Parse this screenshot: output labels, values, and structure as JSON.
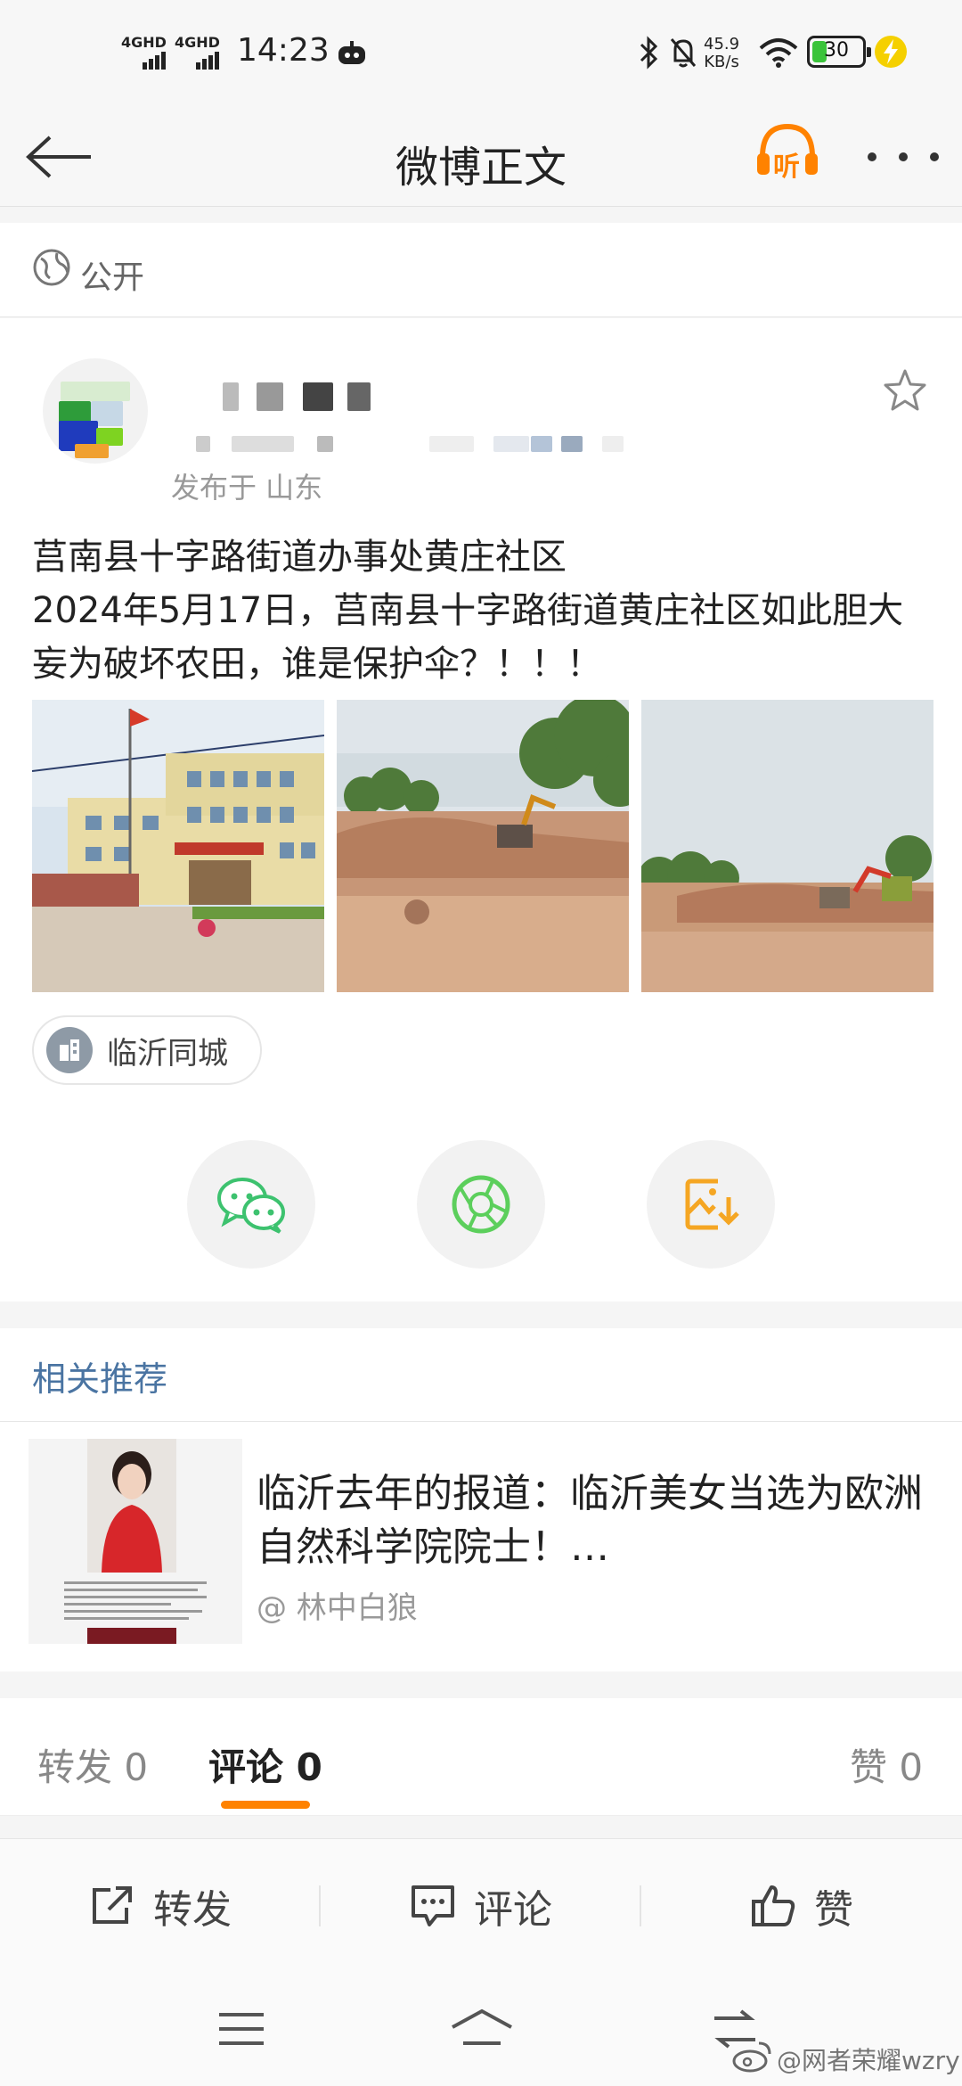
{
  "status_bar": {
    "network_1": "4GHD",
    "network_2": "4GHD",
    "time": "14:23",
    "speed_value": "45.9",
    "speed_unit": "KB/s",
    "battery": "30",
    "battery_level": 0.3
  },
  "nav": {
    "title": "微博正文",
    "listen_label": "听"
  },
  "visibility": {
    "label": "公开"
  },
  "post": {
    "location": "发布于 山东",
    "text_line_1": "莒南县十字路街道办事处黄庄社区",
    "text_line_2": "2024年5月17日，莒南县十字路街道黄庄社区如此胆大妄为破坏农田，谁是保护伞？！！！",
    "tag": "临沂同城"
  },
  "related": {
    "title": "相关推荐",
    "article_title": "临沂去年的报道：临沂美女当选为欧洲自然科学院院士！…",
    "author": "@ 林中白狼"
  },
  "counts": {
    "repost_label": "转发",
    "repost_count": "0",
    "comment_label": "评论",
    "comment_count": "0",
    "like_label": "赞",
    "like_count": "0"
  },
  "actions": {
    "repost": "转发",
    "comment": "评论",
    "like": "赞"
  },
  "watermark": "@网者荣耀wzry",
  "colors": {
    "accent": "#ff8200",
    "link_blue": "#4a74a2",
    "wechat_green": "#3dc26f",
    "moments_green": "#5ccf5c",
    "save_orange": "#f5a623"
  }
}
